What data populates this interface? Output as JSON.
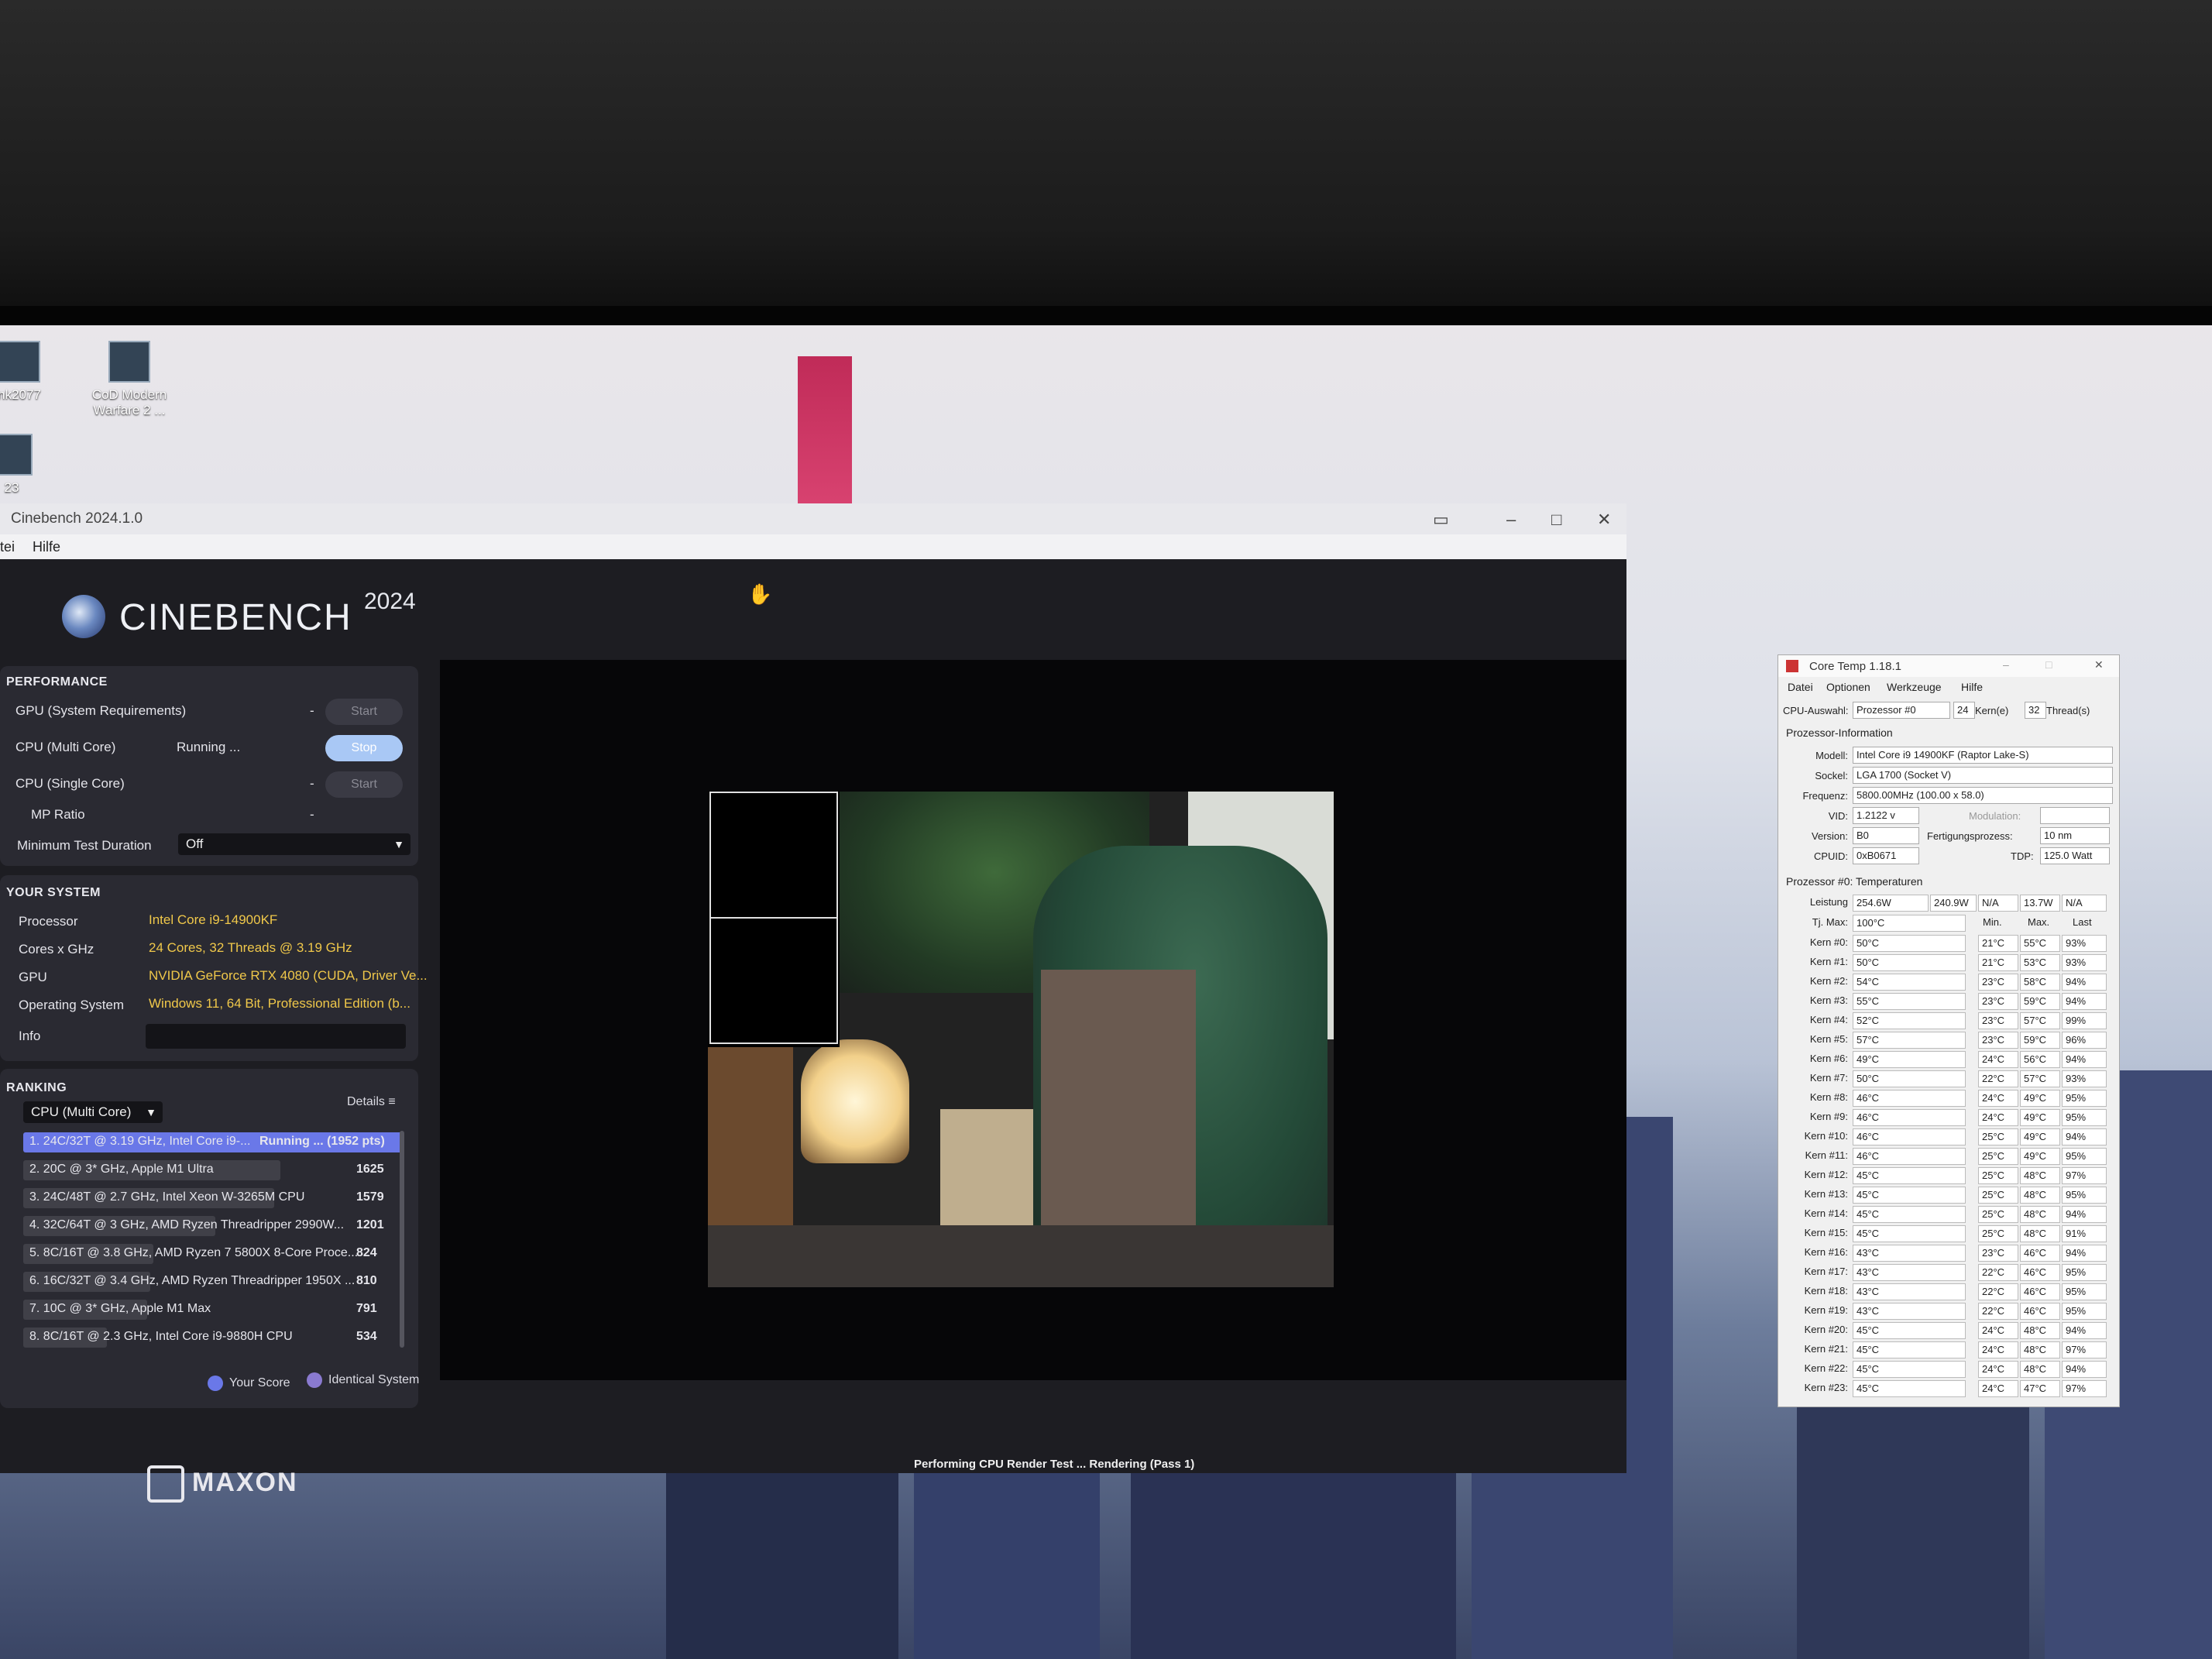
{
  "desktop": {
    "icons": [
      {
        "label": "nk2077"
      },
      {
        "label": "CoD Modern Warfare 2 ..."
      },
      {
        "label": "23"
      }
    ]
  },
  "cinebench": {
    "window_title": "Cinebench 2024.1.0",
    "menu": [
      "tei",
      "Hilfe"
    ],
    "brand": "CINEBENCH",
    "year": "2024",
    "performance": {
      "heading": "PERFORMANCE",
      "rows": [
        {
          "label": "GPU (System Requirements)",
          "status": "-",
          "button": "Start"
        },
        {
          "label": "CPU (Multi Core)",
          "status": "Running ...",
          "button": "Stop"
        },
        {
          "label": "CPU (Single Core)",
          "status": "-",
          "button": "Start"
        },
        {
          "label": "MP Ratio",
          "status": "-"
        }
      ],
      "min_duration_label": "Minimum Test Duration",
      "min_duration_value": "Off"
    },
    "system": {
      "heading": "YOUR SYSTEM",
      "rows": [
        {
          "label": "Processor",
          "value": "Intel Core i9-14900KF"
        },
        {
          "label": "Cores x GHz",
          "value": "24 Cores, 32 Threads @ 3.19 GHz"
        },
        {
          "label": "GPU",
          "value": "NVIDIA GeForce RTX 4080 (CUDA, Driver Ve..."
        },
        {
          "label": "Operating System",
          "value": "Windows 11, 64 Bit, Professional Edition (b..."
        },
        {
          "label": "Info",
          "value": ""
        }
      ]
    },
    "ranking": {
      "heading": "RANKING",
      "selector": "CPU (Multi Core)",
      "details_label": "Details",
      "items": [
        {
          "text": "1. 24C/32T @ 3.19 GHz, Intel Core i9-...",
          "pts": "Running ... (1952 pts)",
          "fill": 1.0,
          "current": true
        },
        {
          "text": "2. 20C @ 3* GHz, Apple M1 Ultra",
          "pts": "1625",
          "fill": 0.83
        },
        {
          "text": "3. 24C/48T @ 2.7 GHz, Intel Xeon W-3265M CPU",
          "pts": "1579",
          "fill": 0.81
        },
        {
          "text": "4. 32C/64T @ 3 GHz, AMD Ryzen Threadripper 2990W...",
          "pts": "1201",
          "fill": 0.62
        },
        {
          "text": "5. 8C/16T @ 3.8 GHz, AMD Ryzen 7 5800X 8-Core Proce...",
          "pts": "824",
          "fill": 0.42
        },
        {
          "text": "6. 16C/32T @ 3.4 GHz, AMD Ryzen Threadripper 1950X ...",
          "pts": "810",
          "fill": 0.41
        },
        {
          "text": "7. 10C @ 3* GHz, Apple M1 Max",
          "pts": "791",
          "fill": 0.4
        },
        {
          "text": "8. 8C/16T @ 2.3 GHz, Intel Core i9-9880H CPU",
          "pts": "534",
          "fill": 0.27
        }
      ],
      "legend_your_score": "Your Score",
      "legend_identical": "Identical System"
    },
    "status": "Performing CPU Render Test ... Rendering (Pass 1)",
    "footer_brand": "MAXON"
  },
  "coretemp": {
    "title": "Core Temp 1.18.1",
    "menu": [
      "Datei",
      "Optionen",
      "Werkzeuge",
      "Hilfe"
    ],
    "cpu_select_label": "CPU-Auswahl:",
    "cpu_select_value": "Prozessor #0",
    "cores": "24",
    "cores_label": "Kern(e)",
    "threads": "32",
    "threads_label": "Thread(s)",
    "info_heading": "Prozessor-Information",
    "modell_label": "Modell:",
    "modell": "Intel Core i9 14900KF (Raptor Lake-S)",
    "sockel_label": "Sockel:",
    "sockel": "LGA 1700 (Socket V)",
    "frequenz_label": "Frequenz:",
    "frequenz": "5800.00MHz (100.00 x 58.0)",
    "vid_label": "VID:",
    "vid": "1.2122 v",
    "modulation_label": "Modulation:",
    "version_label": "Version:",
    "version": "B0",
    "fertigung_label": "Fertigungsprozess:",
    "fertigung": "10 nm",
    "cpuid_label": "CPUID:",
    "cpuid": "0xB0671",
    "tdp_label": "TDP:",
    "tdp": "125.0 Watt",
    "temp_heading": "Prozessor #0: Temperaturen",
    "leistung_label": "Leistung",
    "leistung": [
      "254.6W",
      "240.9W",
      "N/A",
      "13.7W",
      "N/A"
    ],
    "tjmax_label": "Tj. Max:",
    "tjmax": "100°C",
    "col_min": "Min.",
    "col_max": "Max.",
    "col_last": "Last",
    "cores_temps": [
      {
        "name": "Kern #0:",
        "t": "50°C",
        "min": "21°C",
        "max": "55°C",
        "load": "93%"
      },
      {
        "name": "Kern #1:",
        "t": "50°C",
        "min": "21°C",
        "max": "53°C",
        "load": "93%"
      },
      {
        "name": "Kern #2:",
        "t": "54°C",
        "min": "23°C",
        "max": "58°C",
        "load": "94%"
      },
      {
        "name": "Kern #3:",
        "t": "55°C",
        "min": "23°C",
        "max": "59°C",
        "load": "94%"
      },
      {
        "name": "Kern #4:",
        "t": "52°C",
        "min": "23°C",
        "max": "57°C",
        "load": "99%"
      },
      {
        "name": "Kern #5:",
        "t": "57°C",
        "min": "23°C",
        "max": "59°C",
        "load": "96%"
      },
      {
        "name": "Kern #6:",
        "t": "49°C",
        "min": "24°C",
        "max": "56°C",
        "load": "94%"
      },
      {
        "name": "Kern #7:",
        "t": "50°C",
        "min": "22°C",
        "max": "57°C",
        "load": "93%"
      },
      {
        "name": "Kern #8:",
        "t": "46°C",
        "min": "24°C",
        "max": "49°C",
        "load": "95%"
      },
      {
        "name": "Kern #9:",
        "t": "46°C",
        "min": "24°C",
        "max": "49°C",
        "load": "95%"
      },
      {
        "name": "Kern #10:",
        "t": "46°C",
        "min": "25°C",
        "max": "49°C",
        "load": "94%"
      },
      {
        "name": "Kern #11:",
        "t": "46°C",
        "min": "25°C",
        "max": "49°C",
        "load": "95%"
      },
      {
        "name": "Kern #12:",
        "t": "45°C",
        "min": "25°C",
        "max": "48°C",
        "load": "97%"
      },
      {
        "name": "Kern #13:",
        "t": "45°C",
        "min": "25°C",
        "max": "48°C",
        "load": "95%"
      },
      {
        "name": "Kern #14:",
        "t": "45°C",
        "min": "25°C",
        "max": "48°C",
        "load": "94%"
      },
      {
        "name": "Kern #15:",
        "t": "45°C",
        "min": "25°C",
        "max": "48°C",
        "load": "91%"
      },
      {
        "name": "Kern #16:",
        "t": "43°C",
        "min": "23°C",
        "max": "46°C",
        "load": "94%"
      },
      {
        "name": "Kern #17:",
        "t": "43°C",
        "min": "22°C",
        "max": "46°C",
        "load": "95%"
      },
      {
        "name": "Kern #18:",
        "t": "43°C",
        "min": "22°C",
        "max": "46°C",
        "load": "95%"
      },
      {
        "name": "Kern #19:",
        "t": "43°C",
        "min": "22°C",
        "max": "46°C",
        "load": "95%"
      },
      {
        "name": "Kern #20:",
        "t": "45°C",
        "min": "24°C",
        "max": "48°C",
        "load": "94%"
      },
      {
        "name": "Kern #21:",
        "t": "45°C",
        "min": "24°C",
        "max": "48°C",
        "load": "97%"
      },
      {
        "name": "Kern #22:",
        "t": "45°C",
        "min": "24°C",
        "max": "48°C",
        "load": "94%"
      },
      {
        "name": "Kern #23:",
        "t": "45°C",
        "min": "24°C",
        "max": "47°C",
        "load": "97%"
      }
    ]
  }
}
